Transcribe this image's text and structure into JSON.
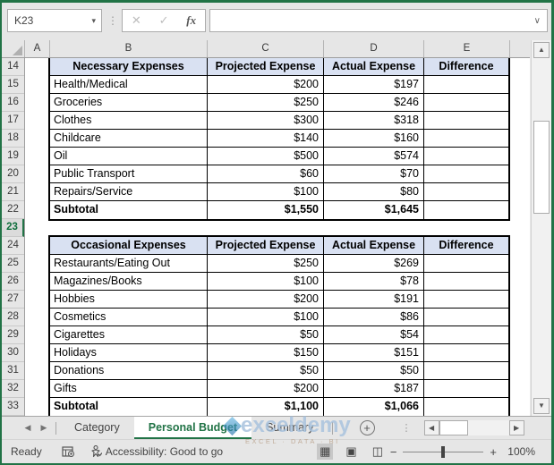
{
  "formula_bar": {
    "name_box_value": "K23",
    "name_box_dropdown_icon": "▾",
    "separator_dots_icon": "⋮",
    "cancel_icon": "✕",
    "enter_icon": "✓",
    "fx_icon": "fx",
    "formula_value": "",
    "expand_icon": "∨"
  },
  "grid": {
    "column_labels": [
      "A",
      "B",
      "C",
      "D",
      "E"
    ],
    "row_numbers": [
      "14",
      "15",
      "16",
      "17",
      "18",
      "19",
      "20",
      "21",
      "22",
      "23",
      "24",
      "25",
      "26",
      "27",
      "28",
      "29",
      "30",
      "31",
      "32",
      "33"
    ],
    "selected_row": "23"
  },
  "tables": [
    {
      "name": "necessary-expenses",
      "headers": [
        "Necessary Expenses",
        "Projected Expense",
        "Actual Expense",
        "Difference"
      ],
      "rows": [
        [
          "Health/Medical",
          "$200",
          "$197",
          ""
        ],
        [
          "Groceries",
          "$250",
          "$246",
          ""
        ],
        [
          "Clothes",
          "$300",
          "$318",
          ""
        ],
        [
          "Childcare",
          "$140",
          "$160",
          ""
        ],
        [
          "Oil",
          "$500",
          "$574",
          ""
        ],
        [
          "Public Transport",
          "$60",
          "$70",
          ""
        ],
        [
          "Repairs/Service",
          "$100",
          "$80",
          ""
        ],
        [
          "Subtotal",
          "$1,550",
          "$1,645",
          ""
        ]
      ]
    },
    {
      "name": "occasional-expenses",
      "headers": [
        "Occasional Expenses",
        "Projected Expense",
        "Actual Expense",
        "Difference"
      ],
      "rows": [
        [
          "Restaurants/Eating Out",
          "$250",
          "$269",
          ""
        ],
        [
          "Magazines/Books",
          "$100",
          "$78",
          ""
        ],
        [
          "Hobbies",
          "$200",
          "$191",
          ""
        ],
        [
          "Cosmetics",
          "$100",
          "$86",
          ""
        ],
        [
          "Cigarettes",
          "$50",
          "$54",
          ""
        ],
        [
          "Holidays",
          "$150",
          "$151",
          ""
        ],
        [
          "Donations",
          "$50",
          "$50",
          ""
        ],
        [
          "Gifts",
          "$200",
          "$187",
          ""
        ],
        [
          "Subtotal",
          "$1,100",
          "$1,066",
          ""
        ]
      ]
    }
  ],
  "sheet_tabs": {
    "nav_left_icon": "◀",
    "nav_right_icon": "▶",
    "tabs": [
      "Category",
      "Personal Budget",
      "Summary"
    ],
    "active_tab": "Personal Budget",
    "add_sheet_icon": "+",
    "dots_icon": "⋮"
  },
  "scrollbars": {
    "up_icon": "▲",
    "down_icon": "▼",
    "left_icon": "◀",
    "right_icon": "▶"
  },
  "status_bar": {
    "ready_label": "Ready",
    "accessibility_label": "Accessibility: Good to go",
    "view_icons": [
      "▦",
      "▣",
      "◫"
    ],
    "zoom_out_icon": "−",
    "zoom_in_icon": "+",
    "zoom_level": "100%"
  },
  "watermark": {
    "brand": "exceldemy",
    "tagline": "EXCEL · DATA · BI"
  },
  "colors": {
    "accent_green": "#217346",
    "table_header_fill": "#D9E1F2"
  }
}
